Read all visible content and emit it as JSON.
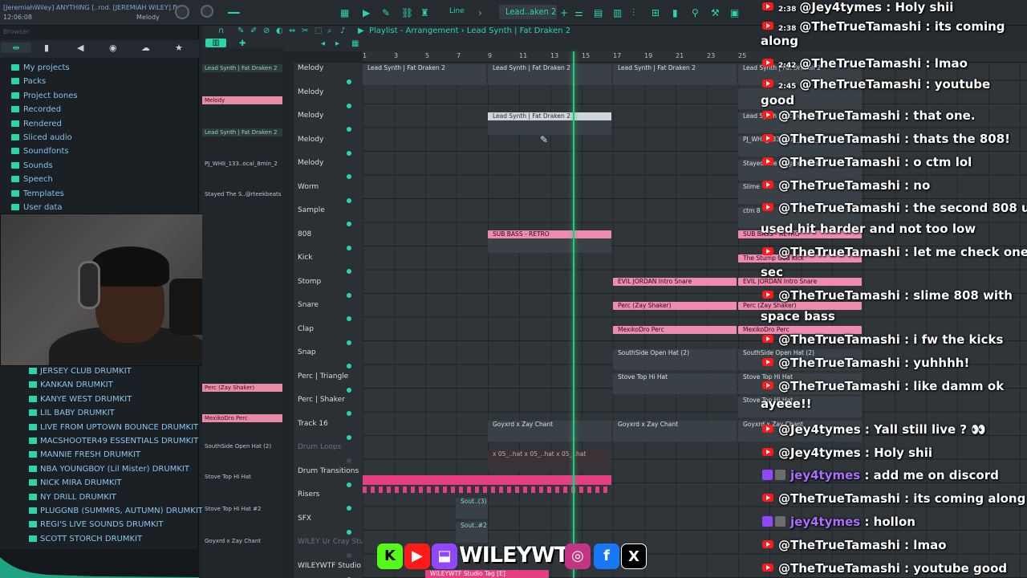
{
  "window": {
    "title": "[JeremiahWiley] ANYTHING [..rod. [JEREMIAH WILEY].flp",
    "time": "12:06:08",
    "channel": "Melody",
    "snap_mode": "Line",
    "pattern": "Lead..aken 2"
  },
  "playlist": {
    "title": "Playlist - Arrangement",
    "breadcrumb_sep": "›",
    "current_clip": "Lead Synth | Fat Draken 2",
    "ruler": [
      "1",
      "3",
      "5",
      "7",
      "9",
      "11",
      "13",
      "15",
      "17",
      "19",
      "21",
      "23",
      "25"
    ],
    "tracks": [
      {
        "name": "Melody",
        "dim": false
      },
      {
        "name": "Melody",
        "dim": false
      },
      {
        "name": "Melody",
        "dim": false
      },
      {
        "name": "Melody",
        "dim": false
      },
      {
        "name": "Melody",
        "dim": false
      },
      {
        "name": "Worm",
        "dim": false
      },
      {
        "name": "Sample",
        "dim": false
      },
      {
        "name": "808",
        "dim": false
      },
      {
        "name": "Kick",
        "dim": false
      },
      {
        "name": "Stomp",
        "dim": false
      },
      {
        "name": "Snare",
        "dim": false
      },
      {
        "name": "Clap",
        "dim": false
      },
      {
        "name": "Snap",
        "dim": false
      },
      {
        "name": "Perc | Triangle",
        "dim": false
      },
      {
        "name": "Perc | Shaker",
        "dim": false
      },
      {
        "name": "Track 16",
        "dim": false
      },
      {
        "name": "Drum Loops",
        "dim": true
      },
      {
        "name": "Drum Transitions",
        "dim": false
      },
      {
        "name": "Risers",
        "dim": false
      },
      {
        "name": "SFX",
        "dim": false
      },
      {
        "name": "WILEY Ur Cray Stu...",
        "dim": true
      },
      {
        "name": "WILEYWTF Studio T...",
        "dim": false
      }
    ],
    "clips": {
      "lead": "Lead Synth | Fat Draken 2",
      "sub_bass": "SUB BASS - RETRO",
      "stump": "The Stump God Kick",
      "evil_snare": "EVIL JORDAN Intro Snare",
      "perc_zay": "Perc (Zay Shaker)",
      "mexikodro": "MexikoDro Perc",
      "southside": "SouthSide Open Hat (2)",
      "stove": "Stove Top Hi Hat",
      "stove2": "Stove Top Hi Hat",
      "goyxrd": "Goyxrd x Zay Chant",
      "drum_loops": "x 05_..hat x 05_..hat x 05_..hat",
      "sout3": "Sout..(3)",
      "sout2": "Sout..#2",
      "wiley_tag": "WILEYWTF Studio Tag [E]",
      "pj": "PJ_WHII_133..ocal_8min_2",
      "stayed": "Stayed The S..@rteekbeats",
      "slime": "Slime",
      "ctm": "ctm 8"
    }
  },
  "rack": {
    "items": [
      {
        "label": "Lead Synth | Fat Draken 2",
        "style": "green"
      },
      {
        "label": "Melody",
        "style": "pink"
      },
      {
        "label": "Lead Synth | Fat Draken 2",
        "style": "green"
      },
      {
        "label": "PJ_WHII_133..ocal_8min_2",
        "style": "label"
      },
      {
        "label": "Stayed The S..@rteekbeats",
        "style": "label"
      },
      {
        "label": "Perc (Zay Shaker)",
        "style": "pink"
      },
      {
        "label": "MexikoDro Perc",
        "style": "pink"
      },
      {
        "label": "SouthSide Open Hat (2)",
        "style": "label"
      },
      {
        "label": "Stove Top Hi Hat",
        "style": "label"
      },
      {
        "label": "Stove Top Hi Hat #2",
        "style": "label"
      },
      {
        "label": "Goyxrd x Zay Chant",
        "style": "label"
      }
    ]
  },
  "browser": {
    "search_placeholder": "Browser",
    "folders": [
      "My projects",
      "Packs",
      "Project bones",
      "Recorded",
      "Rendered",
      "Sliced audio",
      "Soundfonts",
      "Sounds",
      "Speech",
      "Templates",
      "User data"
    ],
    "kits": [
      "JERSEY CLUB DRUMKIT",
      "KANKAN DRUMKIT",
      "KANYE WEST DRUMKIT",
      "LIL BABY DRUMKIT",
      "LIVE FROM UPTOWN BOUNCE DRUMKIT",
      "MACSHOOTER49 ESSENTIALS DRUMKIT",
      "MANNIE FRESH DRUMKIT",
      "NBA YOUNGBOY (Lil Mister) DRUMKIT",
      "NICK MIRA DRUMKIT",
      "NY DRILL DRUMKIT",
      "PLUGGNB (SUMMRS, AUTUMN) DRUMKIT",
      "REGI'S LIVE SOUNDS DRUMKIT",
      "SCOTT STORCH DRUMKIT"
    ]
  },
  "chat": [
    {
      "platform": "yt",
      "time": "2:38",
      "user": "@Jey4tymes",
      "text": "Holy shii"
    },
    {
      "platform": "yt",
      "time": "2:38",
      "user": "@TheTrueTamashi",
      "text": "its coming",
      "cont": "along"
    },
    {
      "platform": "yt",
      "time": "2:42",
      "user": "@TheTrueTamashi",
      "text": "lmao"
    },
    {
      "platform": "yt",
      "time": "2:45",
      "user": "@TheTrueTamashi",
      "text": "youtube",
      "cont": "good"
    },
    {
      "platform": "yt",
      "time": "",
      "user": "@TheTrueTamashi",
      "text": "that one."
    },
    {
      "platform": "yt",
      "time": "",
      "user": "@TheTrueTamashi",
      "text": "thats the 808!"
    },
    {
      "platform": "yt",
      "time": "",
      "user": "@TheTrueTamashi",
      "text": "o ctm lol"
    },
    {
      "platform": "yt",
      "time": "",
      "user": "@TheTrueTamashi",
      "text": "no"
    },
    {
      "platform": "yt",
      "time": "",
      "user": "@TheTrueTamashi",
      "text": "the second 808 u",
      "cont": "used hit harder and not too low"
    },
    {
      "platform": "yt",
      "time": "",
      "user": "@TheTrueTamashi",
      "text": "let me check one",
      "cont": "sec"
    },
    {
      "platform": "yt",
      "time": "",
      "user": "@TheTrueTamashi",
      "text": "slime 808 with",
      "cont": "space bass"
    },
    {
      "platform": "yt",
      "time": "",
      "user": "@TheTrueTamashi",
      "text": "i fw the kicks"
    },
    {
      "platform": "yt",
      "time": "",
      "user": "@TheTrueTamashi",
      "text": "yuhhhh!"
    },
    {
      "platform": "yt",
      "time": "",
      "user": "@TheTrueTamashi",
      "text": "like damm ok",
      "cont": "ayeee!!"
    },
    {
      "platform": "yt",
      "time": "",
      "user": "@Jey4tymes",
      "text": "Yall still live ? 👀"
    },
    {
      "platform": "yt",
      "time": "",
      "user": "@Jey4tymes",
      "text": "Holy shii"
    },
    {
      "platform": "tw",
      "time": "",
      "user": "jey4tymes",
      "text": "add me on discord"
    },
    {
      "platform": "yt",
      "time": "",
      "user": "@TheTrueTamashi",
      "text": "its coming along"
    },
    {
      "platform": "tw",
      "time": "",
      "user": "jey4tymes",
      "text": "hollon"
    },
    {
      "platform": "yt",
      "time": "",
      "user": "@TheTrueTamashi",
      "text": "lmao"
    },
    {
      "platform": "yt",
      "time": "",
      "user": "@TheTrueTamashi",
      "text": "youtube good"
    }
  ],
  "social": {
    "wordmark": "WILEYWTF",
    "icons": [
      "kick-icon",
      "youtube-icon",
      "twitch-icon",
      "instagram-icon",
      "facebook-icon",
      "x-icon"
    ],
    "fb": "f",
    "x": "X",
    "k": "K"
  },
  "colors": {
    "accent": "#2bd5a7",
    "pink_clip": "#f08bb0",
    "playhead": "#28c97f",
    "youtube": "#ff1a1a",
    "twitch": "#9146ff"
  }
}
